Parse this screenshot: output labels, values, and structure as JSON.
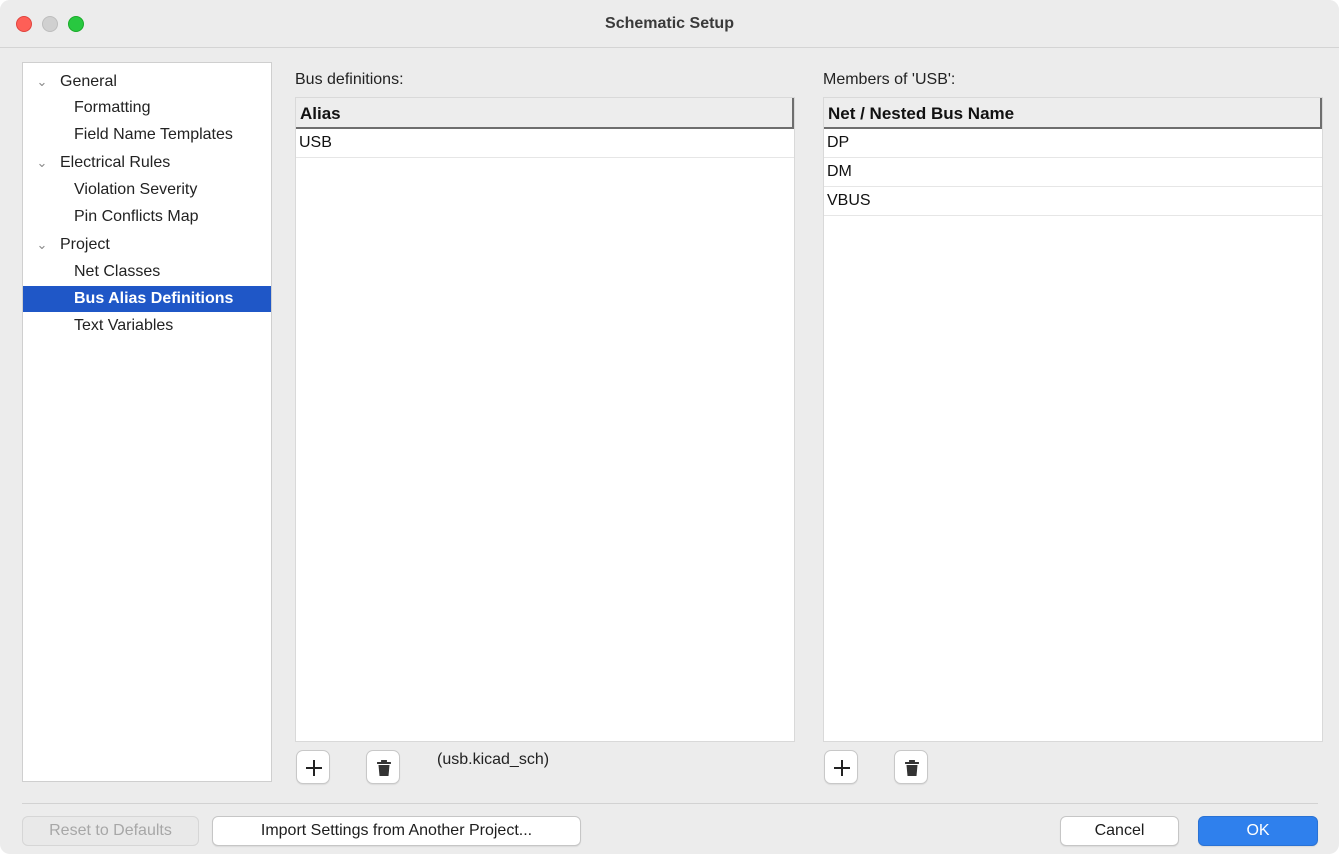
{
  "window": {
    "title": "Schematic Setup"
  },
  "tree": {
    "items": [
      {
        "label": "General",
        "type": "group",
        "expanded": true
      },
      {
        "label": "Formatting",
        "type": "child"
      },
      {
        "label": "Field Name Templates",
        "type": "child"
      },
      {
        "label": "Electrical Rules",
        "type": "group",
        "expanded": true
      },
      {
        "label": "Violation Severity",
        "type": "child"
      },
      {
        "label": "Pin Conflicts Map",
        "type": "child"
      },
      {
        "label": "Project",
        "type": "group",
        "expanded": true
      },
      {
        "label": "Net Classes",
        "type": "child"
      },
      {
        "label": "Bus Alias Definitions",
        "type": "child",
        "selected": true
      },
      {
        "label": "Text Variables",
        "type": "child"
      }
    ]
  },
  "bus_definitions": {
    "label": "Bus definitions:",
    "column": "Alias",
    "rows": [
      "USB"
    ],
    "source": "(usb.kicad_sch)"
  },
  "members": {
    "label": "Members of 'USB':",
    "column": "Net / Nested Bus Name",
    "rows": [
      "DP",
      "DM",
      "VBUS"
    ]
  },
  "footer": {
    "reset_label": "Reset to Defaults",
    "import_label": "Import Settings from Another Project...",
    "cancel_label": "Cancel",
    "ok_label": "OK"
  },
  "colors": {
    "selection": "#1f57c7",
    "primary_button": "#2f80ed",
    "close": "#fe5f57",
    "maximize": "#28c840"
  }
}
